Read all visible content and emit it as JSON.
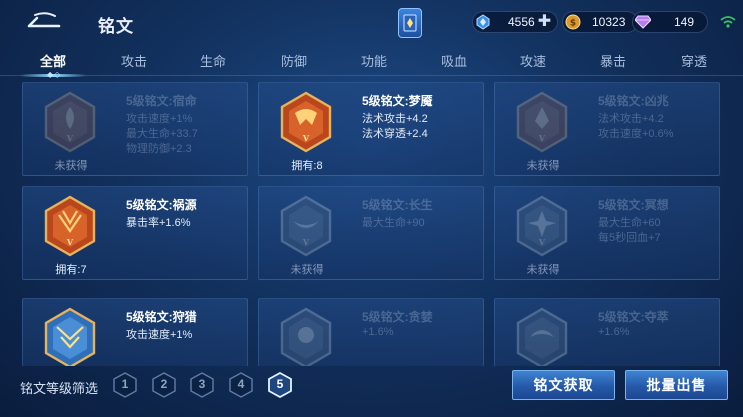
{
  "header": {
    "title": "铭文",
    "currencies": [
      {
        "icon": "coupon-diamond-icon",
        "value": "4556",
        "color": "#4aa3ff"
      },
      {
        "icon": "gold-coin-icon",
        "value": "10323",
        "color": "#e6a43a"
      },
      {
        "icon": "purple-gem-icon",
        "value": "149",
        "color": "#c78cff"
      }
    ]
  },
  "tabs": [
    "全部",
    "攻击",
    "生命",
    "防御",
    "功能",
    "吸血",
    "攻速",
    "暴击",
    "穿透"
  ],
  "active_tab": "全部",
  "cards": [
    {
      "name": "5级铭文:宿命",
      "stats": [
        "攻击速度+1%",
        "最大生命+33.7",
        "物理防御+2.3"
      ],
      "owned": "未获得",
      "locked": true,
      "theme": "red"
    },
    {
      "name": "5级铭文:梦魇",
      "stats": [
        "法术攻击+4.2",
        "法术穿透+2.4"
      ],
      "owned": "拥有:8",
      "locked": false,
      "theme": "red"
    },
    {
      "name": "5级铭文:凶兆",
      "stats": [
        "法术攻击+4.2",
        "攻击速度+0.6%"
      ],
      "owned": "未获得",
      "locked": true,
      "theme": "red"
    },
    {
      "name": "5级铭文:祸源",
      "stats": [
        "暴击率+1.6%"
      ],
      "owned": "拥有:7",
      "locked": false,
      "theme": "red"
    },
    {
      "name": "5级铭文:长生",
      "stats": [
        "最大生命+90"
      ],
      "owned": "未获得",
      "locked": true,
      "theme": "blue"
    },
    {
      "name": "5级铭文:冥想",
      "stats": [
        "最大生命+60",
        "每5秒回血+7"
      ],
      "owned": "未获得",
      "locked": true,
      "theme": "blue"
    },
    {
      "name": "5级铭文:狩猎",
      "stats": [
        "攻击速度+1%"
      ],
      "owned": "",
      "locked": false,
      "theme": "blue"
    },
    {
      "name": "5级铭文:贪婪",
      "stats": [
        "+1.6%"
      ],
      "owned": "",
      "locked": true,
      "theme": "blue"
    },
    {
      "name": "5级铭文:夺萃",
      "stats": [
        "+1.6%"
      ],
      "owned": "",
      "locked": true,
      "theme": "blue"
    }
  ],
  "bottom": {
    "filter_label": "铭文等级筛选",
    "levels": [
      "1",
      "2",
      "3",
      "4",
      "5"
    ],
    "active_level": "5",
    "obtain_label": "铭文获取",
    "batch_sell_label": "批量出售"
  }
}
